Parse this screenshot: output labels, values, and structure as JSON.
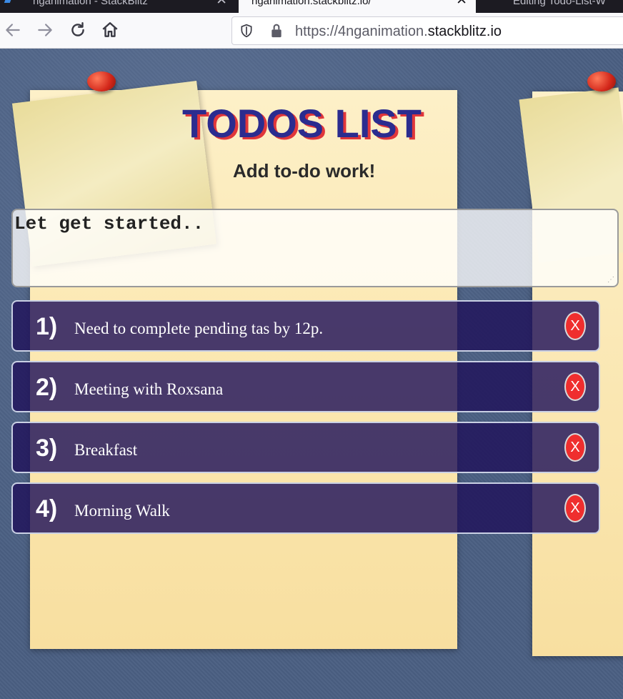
{
  "browser": {
    "tabs": [
      {
        "label": "nganimation - StackBlitz",
        "active": false
      },
      {
        "label": "nganimation.stackblitz.io/",
        "active": true
      },
      {
        "label": "Editing Todo-List-W",
        "active": false
      }
    ],
    "tab_close_glyph": "✕",
    "url_prefix": "https://4nganimation.",
    "url_domain": "stackblitz.io",
    "nav_icons": [
      "back-arrow-icon",
      "forward-arrow-icon",
      "reload-icon",
      "home-icon",
      "shield-icon",
      "lock-icon"
    ]
  },
  "app": {
    "title": "TODOS LIST",
    "subtitle": "Add to-do work!",
    "input_placeholder": "Let get started..",
    "todos": [
      {
        "num": "1)",
        "text": "Need to complete pending tas by 12p.",
        "delete_label": "X"
      },
      {
        "num": "2)",
        "text": "Meeting with Roxsana",
        "delete_label": "X"
      },
      {
        "num": "3)",
        "text": "Breakfast",
        "delete_label": "X"
      },
      {
        "num": "4)",
        "text": "Morning Walk",
        "delete_label": "X"
      }
    ],
    "colors": {
      "title": "#2b2c8f",
      "title_shadow": "#e0363a",
      "item_bg": "#20125a",
      "delete_button": "#ef2e2e",
      "board_bg": "#4a5f82"
    }
  }
}
